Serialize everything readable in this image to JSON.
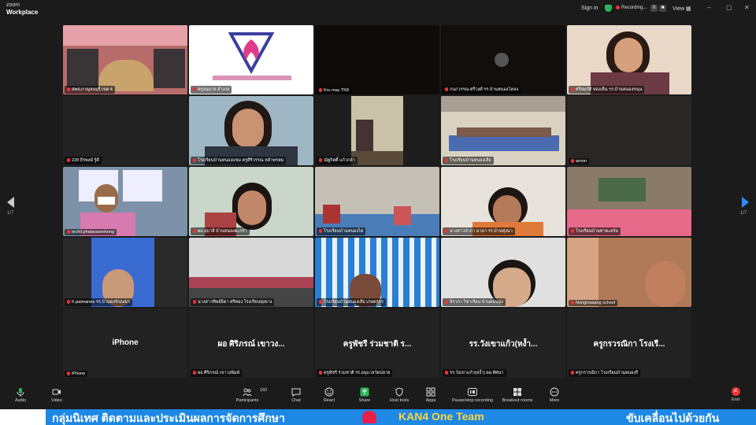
{
  "app": {
    "brand_top": "zoom",
    "brand_name": "Workplace"
  },
  "topbar": {
    "sign_in": "Sign in",
    "recording": "Recording...",
    "view": "View",
    "pause": "II",
    "stop": "■"
  },
  "pager": {
    "left": "1/7",
    "right": "1/7"
  },
  "participants": [
    {
      "name": "สพป.กาญจนบุรี เขต 4",
      "scene": "meeting",
      "active": true
    },
    {
      "name": "ครูอนุบาล อำเภอ",
      "scene": "logo"
    },
    {
      "name": "Kru may TK8",
      "scene": "dark"
    },
    {
      "name": "กนกวรรณ ศรีวงศ์ รร.บ้านหนองโคลง",
      "scene": "dark-icon"
    },
    {
      "name": "ศรีสมบัติ ทองเย็น รร.บ้านหนองขนุน",
      "scene": "woman"
    },
    {
      "name": "228 ธีรพงษ์ รู้ดี",
      "scene": "black"
    },
    {
      "name": "โรงเรียนบ้านหนองแขม ครูศิริวรรณ หล้าพรหม",
      "scene": "woman2"
    },
    {
      "name": "ณัฐกิตติ์ แก้วกล้า",
      "scene": "office"
    },
    {
      "name": "โรงเรียนบ้านหนองเสือ",
      "scene": "classroom"
    },
    {
      "name": "arnon",
      "scene": "grey"
    },
    {
      "name": "techit.phataraseekong",
      "scene": "man"
    },
    {
      "name": "ผอ.สุมาลี บ้านหนองตะกร้า",
      "scene": "woman3"
    },
    {
      "name": "โรงเรียนบ้านหนองไผ่",
      "scene": "room"
    },
    {
      "name": "นางสาวบำภา มามา รร.บ้านทุ่งนา",
      "scene": "woman4"
    },
    {
      "name": "โรงเรียนบ้านท่าตะคร้อ",
      "scene": "group"
    },
    {
      "name": "K.paimanee รร.บ้านดงรักดงยา",
      "scene": "poster"
    },
    {
      "name": "นางสาวทิพย์ธิดา ศรีทอง โรงเรียนทุ่งยาง",
      "scene": "shelf"
    },
    {
      "name": "โรงเรียนบ้านหนองเสือ เกษตรกร",
      "scene": "tent"
    },
    {
      "name": "จิราภา วิชาเรียน บ้านดอนสูง",
      "scene": "glasses"
    },
    {
      "name": "Nongmasang school",
      "scene": "group2"
    }
  ],
  "audio_only": [
    {
      "big": "iPhone",
      "name": "iPhone"
    },
    {
      "big": "ผอ ศิริภรณ์ เขาวง...",
      "name": "ผอ ศิริภรณ์ เขาวงพิมพ์"
    },
    {
      "big": "ครูพัชรี ร่วมชาติ ร...",
      "name": "ครูพัชรี ร่วมชาติ รร.อนุบาลวัดปลาย"
    },
    {
      "big": "รร.วังเขาแก้ว(หง้ำ...",
      "name": "รร.วังเขาแก้ว(หง้ำ) ผอ.ทัศนา"
    },
    {
      "big": "ครูกรวรณิกา โรงเรี...",
      "name": "ครูกรวรณิกา โรงเรียนบ้านหนองรี"
    }
  ],
  "toolbar": {
    "audio": "Audio",
    "video": "Video",
    "participants": "Participants",
    "participants_count": "160",
    "chat": "Chat",
    "react": "React",
    "share": "Share",
    "host_tools": "Host tools",
    "apps": "Apps",
    "pause_stop": "Pause/stop recording",
    "breakout": "Breakout rooms",
    "more": "More",
    "end": "End"
  },
  "ticker": {
    "part1": "กลุ่มนิเทศ ติดตามและประเมินผลการจัดการศึกษา",
    "part2": "KAN4 One Team",
    "part3": "ขับเคลื่อนไปด้วยกัน"
  },
  "colors": {
    "active_border": "#23d160",
    "ticker_bg": "#1e88e5",
    "end_red": "#e33333"
  }
}
